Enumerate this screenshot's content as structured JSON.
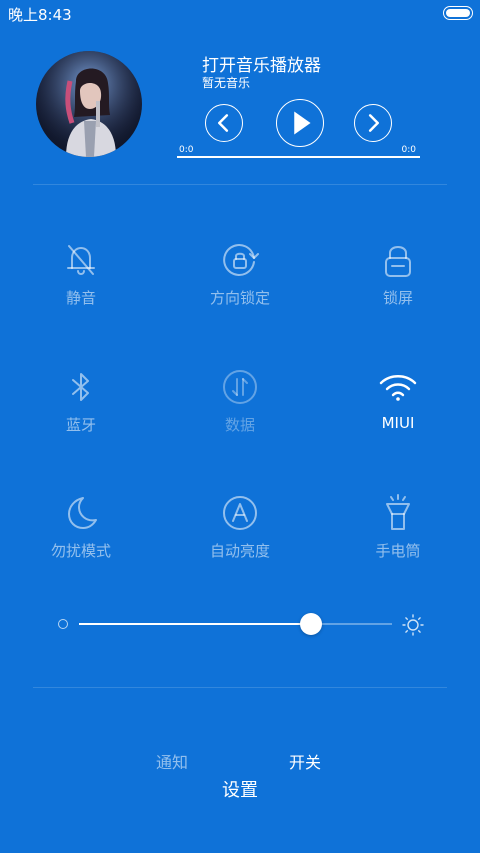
{
  "status_bar": {
    "time": "晚上8:43",
    "battery_icon": "battery-icon"
  },
  "music": {
    "title": "打开音乐播放器",
    "subtitle": "暂无音乐",
    "time_start": "0:0",
    "time_end": "0:0",
    "progress": 0,
    "controls": [
      "previous-icon",
      "play-icon",
      "next-icon"
    ]
  },
  "toggles": [
    {
      "label": "静音",
      "icon": "bell-off-icon",
      "state": "off"
    },
    {
      "label": "方向锁定",
      "icon": "rotation-lock-icon",
      "state": "off"
    },
    {
      "label": "锁屏",
      "icon": "lock-icon",
      "state": "off"
    },
    {
      "label": "蓝牙",
      "icon": "bluetooth-icon",
      "state": "off"
    },
    {
      "label": "数据",
      "icon": "data-icon",
      "state": "disabled"
    },
    {
      "label": "MIUI",
      "icon": "wifi-icon",
      "state": "on"
    },
    {
      "label": "勿扰模式",
      "icon": "moon-icon",
      "state": "off"
    },
    {
      "label": "自动亮度",
      "icon": "auto-brightness-icon",
      "state": "off"
    },
    {
      "label": "手电筒",
      "icon": "flashlight-icon",
      "state": "off"
    }
  ],
  "brightness": {
    "level": 0.74
  },
  "tabs": {
    "notify": "通知",
    "switch": "开关",
    "active": "switch"
  },
  "settings": "设置",
  "colors": {
    "background": "#0f72d8",
    "foreground": "#ffffff"
  }
}
